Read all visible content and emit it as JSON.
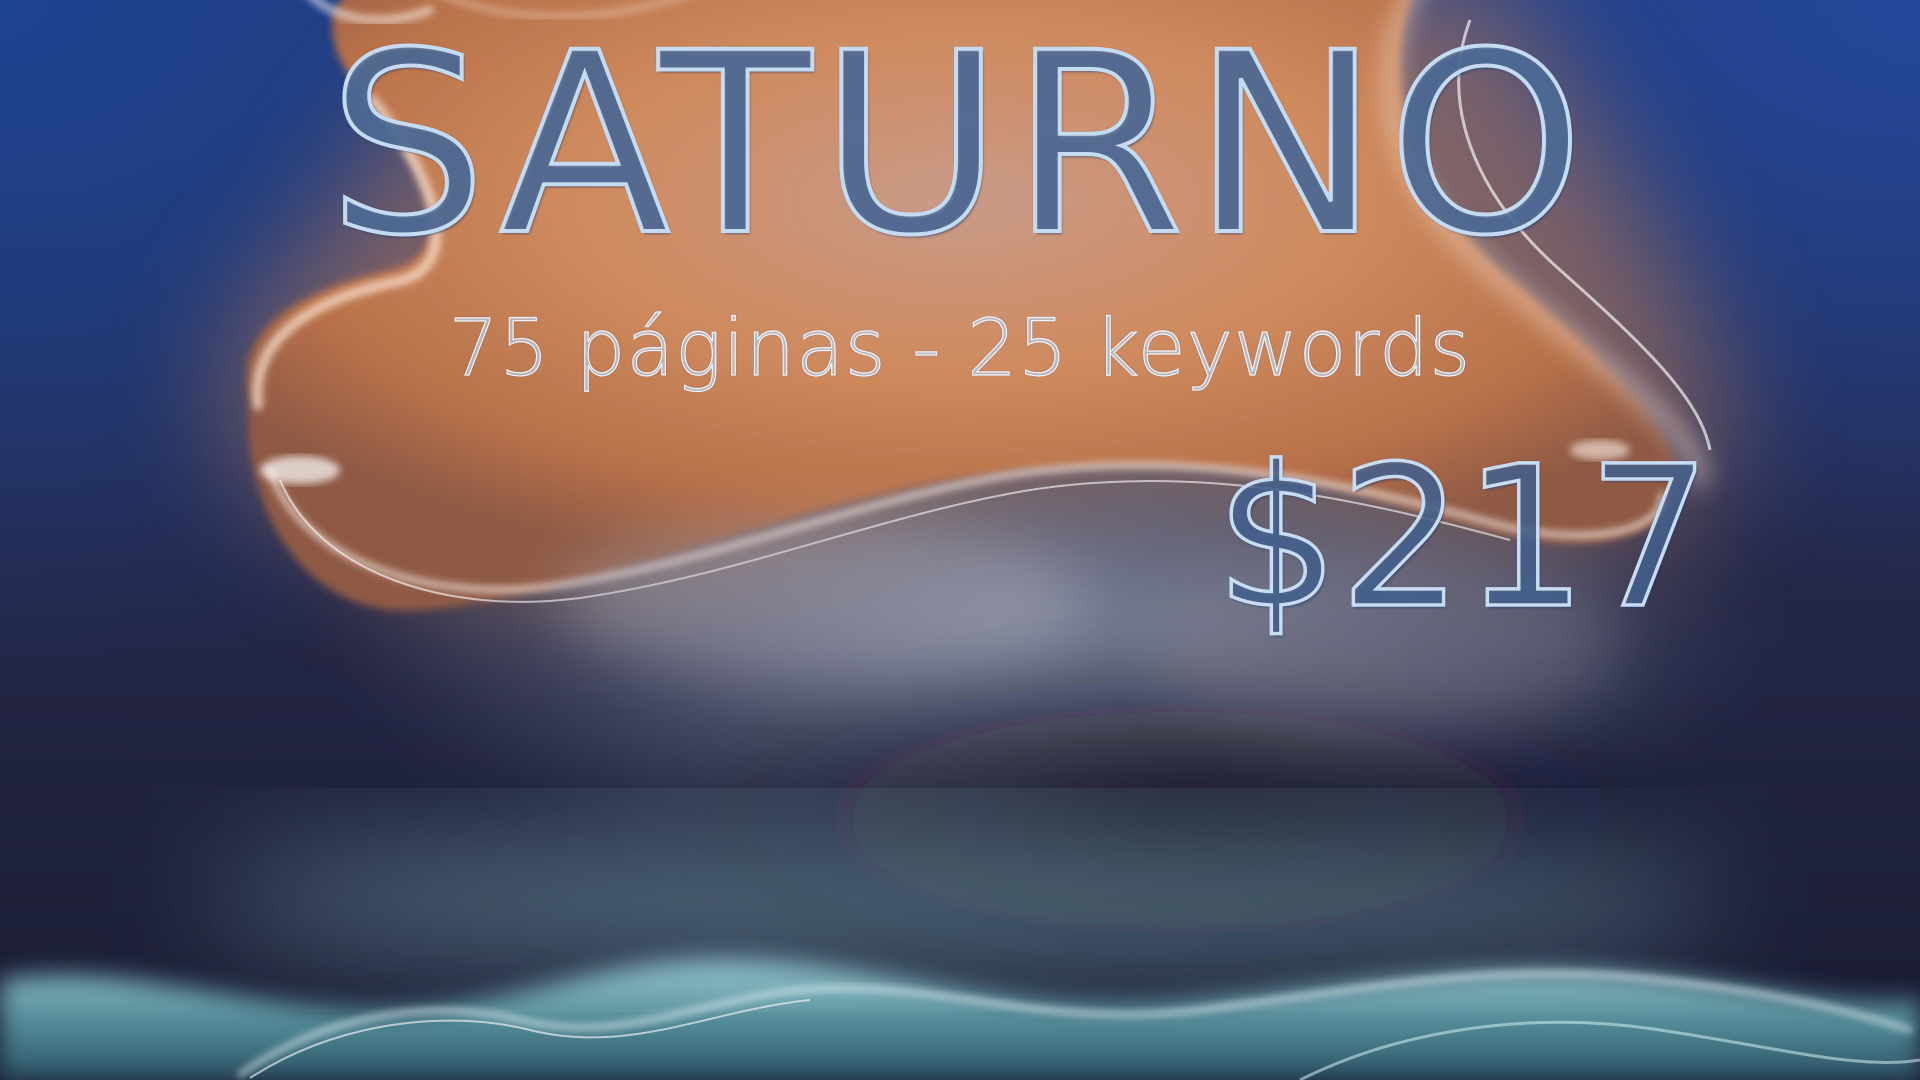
{
  "hero": {
    "title": "SATURNO",
    "subtitle": "75 páginas - 25 keywords",
    "price": "$217"
  },
  "colors": {
    "background_dark_blue": "#1b2250",
    "background_corner_blue": "#1f3f82",
    "orange_blob": "#d48a5c",
    "teal_wave": "#78c2cc",
    "lettering": "#c4dbf1"
  }
}
